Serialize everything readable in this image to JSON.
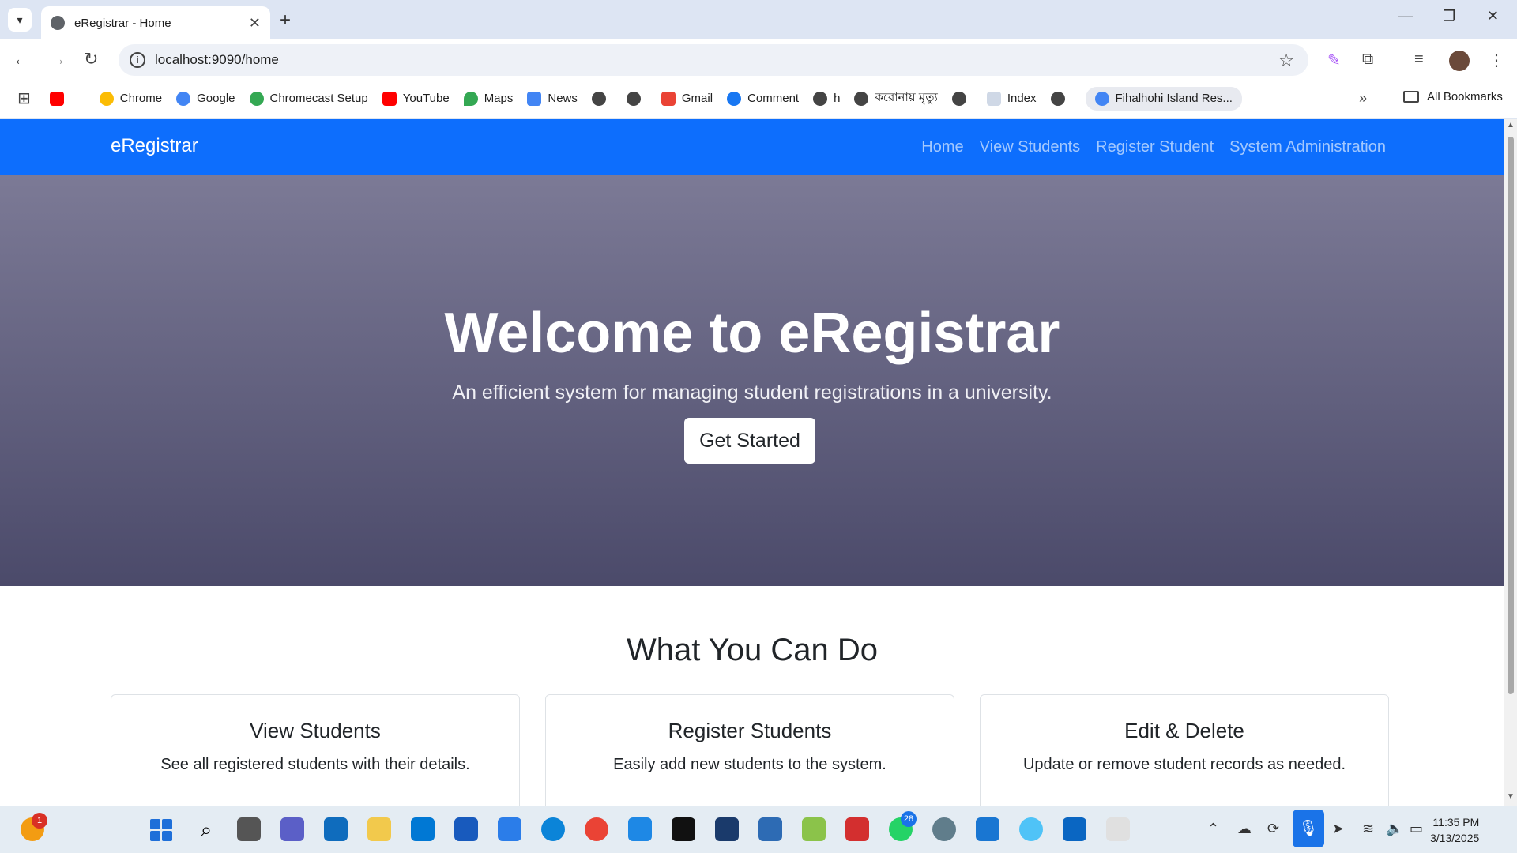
{
  "browser": {
    "tab_title": "eRegistrar - Home",
    "url": "localhost:9090/home",
    "bookmarks": [
      "Chrome",
      "Google",
      "Chromecast Setup",
      "YouTube",
      "Maps",
      "News",
      "Gmail",
      "Comment",
      "h",
      "করোনায় মৃত্যু",
      "Index",
      "Fihalhohi Island Res..."
    ],
    "all_bookmarks": "All Bookmarks"
  },
  "app": {
    "brand": "eRegistrar",
    "nav": [
      "Home",
      "View Students",
      "Register Student",
      "System Administration"
    ],
    "hero": {
      "title": "Welcome to eRegistrar",
      "subtitle": "An efficient system for managing student registrations in a university.",
      "cta": "Get Started"
    },
    "features_title": "What You Can Do",
    "cards": [
      {
        "title": "View Students",
        "text": "See all registered students with their details."
      },
      {
        "title": "Register Students",
        "text": "Easily add new students to the system."
      },
      {
        "title": "Edit & Delete",
        "text": "Update or remove student records as needed."
      }
    ]
  },
  "taskbar": {
    "weather_badge": "1",
    "whatsapp_badge": "28",
    "time": "11:35 PM",
    "date": "3/13/2025"
  },
  "colors": {
    "navbar": "#0d6efd",
    "hero_top": "#7c7a96",
    "hero_bottom": "#4b4a6a"
  }
}
